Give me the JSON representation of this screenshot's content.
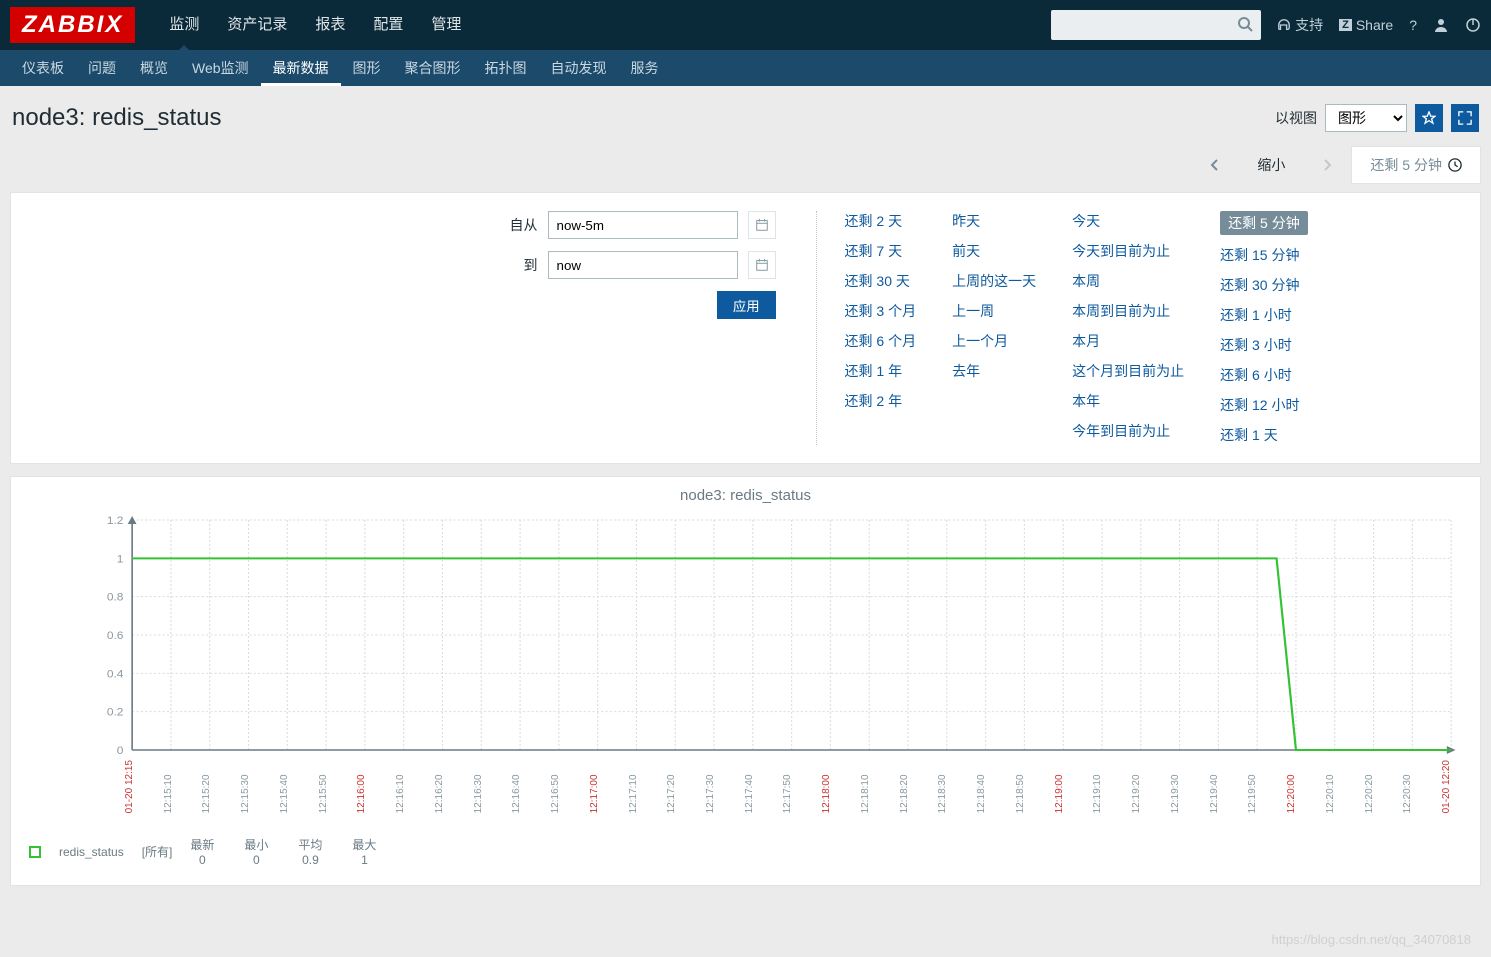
{
  "header": {
    "logo": "ZABBIX",
    "nav": [
      "监测",
      "资产记录",
      "报表",
      "配置",
      "管理"
    ],
    "nav_active": 0,
    "support": "支持",
    "share": "Share"
  },
  "subnav": {
    "items": [
      "仪表板",
      "问题",
      "概览",
      "Web监测",
      "最新数据",
      "图形",
      "聚合图形",
      "拓扑图",
      "自动发现",
      "服务"
    ],
    "active": 4
  },
  "page": {
    "title": "node3: redis_status",
    "view_as_label": "以视图",
    "view_as_value": "图形"
  },
  "timenav": {
    "zoom_out": "缩小",
    "current": "还剩 5 分钟"
  },
  "filter": {
    "from_label": "自从",
    "from_value": "now-5m",
    "to_label": "到",
    "to_value": "now",
    "apply": "应用",
    "presets": {
      "col1": [
        "还剩 2 天",
        "还剩 7 天",
        "还剩 30 天",
        "还剩 3 个月",
        "还剩 6 个月",
        "还剩 1 年",
        "还剩 2 年"
      ],
      "col2": [
        "昨天",
        "前天",
        "上周的这一天",
        "上一周",
        "上一个月",
        "去年"
      ],
      "col3": [
        "今天",
        "今天到目前为止",
        "本周",
        "本周到目前为止",
        "本月",
        "这个月到目前为止",
        "本年",
        "今年到目前为止"
      ],
      "col4": [
        "还剩 5 分钟",
        "还剩 15 分钟",
        "还剩 30 分钟",
        "还剩 1 小时",
        "还剩 3 小时",
        "还剩 6 小时",
        "还剩 12 小时",
        "还剩 1 天"
      ],
      "col4_selected": 0
    }
  },
  "chart_data": {
    "type": "line",
    "title": "node3: redis_status",
    "ylabel": "",
    "ylim": [
      0,
      1.2
    ],
    "yticks": [
      0,
      0.2,
      0.4,
      0.6,
      0.8,
      1.0,
      1.2
    ],
    "x_start": "01-20 12:15",
    "x_end": "01-20 12:20",
    "xticks": [
      "01-20 12:15",
      "12:15:10",
      "12:15:20",
      "12:15:30",
      "12:15:40",
      "12:15:50",
      "12:16:00",
      "12:16:10",
      "12:16:20",
      "12:16:30",
      "12:16:40",
      "12:16:50",
      "12:17:00",
      "12:17:10",
      "12:17:20",
      "12:17:30",
      "12:17:40",
      "12:17:50",
      "12:18:00",
      "12:18:10",
      "12:18:20",
      "12:18:30",
      "12:18:40",
      "12:18:50",
      "12:19:00",
      "12:19:10",
      "12:19:20",
      "12:19:30",
      "12:19:40",
      "12:19:50",
      "12:20:00",
      "12:20:10",
      "12:20:20",
      "12:20:30",
      "01-20 12:20"
    ],
    "xticks_red": [
      0,
      6,
      12,
      18,
      24,
      30,
      34
    ],
    "series": [
      {
        "name": "redis_status",
        "color": "#34c234",
        "x": [
          0,
          10,
          20,
          30,
          40,
          50,
          60,
          70,
          80,
          90,
          100,
          110,
          120,
          130,
          140,
          150,
          160,
          170,
          180,
          190,
          200,
          210,
          220,
          230,
          240,
          250,
          260,
          270,
          280,
          290,
          295,
          300,
          310,
          320,
          330,
          340
        ],
        "values": [
          1,
          1,
          1,
          1,
          1,
          1,
          1,
          1,
          1,
          1,
          1,
          1,
          1,
          1,
          1,
          1,
          1,
          1,
          1,
          1,
          1,
          1,
          1,
          1,
          1,
          1,
          1,
          1,
          1,
          1,
          1,
          0,
          0,
          0,
          0,
          0
        ]
      }
    ],
    "legend": {
      "name": "redis_status",
      "scope": "[所有]",
      "stats": {
        "最新": "0",
        "最小": "0",
        "平均": "0.9",
        "最大": "1"
      }
    }
  },
  "watermark": "https://blog.csdn.net/qq_34070818"
}
